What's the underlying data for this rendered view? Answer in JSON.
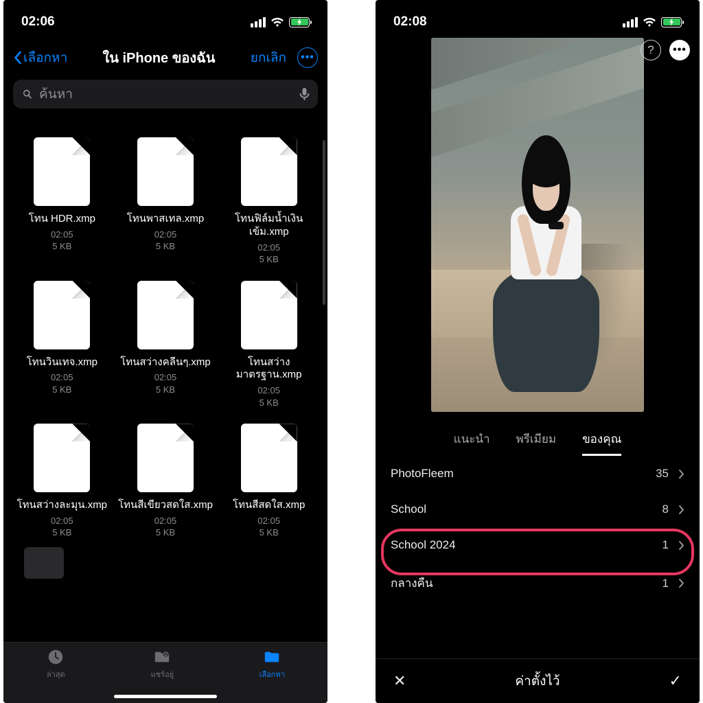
{
  "left": {
    "status": {
      "time": "02:06"
    },
    "nav": {
      "back": "เลือกหา",
      "title": "ใน iPhone ของฉัน",
      "cancel": "ยกเลิก"
    },
    "search": {
      "placeholder": "ค้นหา"
    },
    "files": [
      {
        "name": "โทน HDR.xmp",
        "time": "02:05",
        "size": "5 KB"
      },
      {
        "name": "โทนพาสเทล.xmp",
        "time": "02:05",
        "size": "5 KB"
      },
      {
        "name": "โทนฟิล์มน้ำเงินเข้ม.xmp",
        "time": "02:05",
        "size": "5 KB"
      },
      {
        "name": "โทนวินเทจ.xmp",
        "time": "02:05",
        "size": "5 KB"
      },
      {
        "name": "โทนสว่างคลีนๆ.xmp",
        "time": "02:05",
        "size": "5 KB"
      },
      {
        "name": "โทนสว่างมาตรฐาน.xmp",
        "time": "02:05",
        "size": "5 KB"
      },
      {
        "name": "โทนสว่างละมุน.xmp",
        "time": "02:05",
        "size": "5 KB"
      },
      {
        "name": "โทนสีเขียวสดใส.xmp",
        "time": "02:05",
        "size": "5 KB"
      },
      {
        "name": "โทนสีสดใส.xmp",
        "time": "02:05",
        "size": "5 KB"
      }
    ],
    "tabs": {
      "recent": "ล่าสุด",
      "shared": "แชร์อยู่",
      "browse": "เลือกหา"
    }
  },
  "right": {
    "status": {
      "time": "02:08"
    },
    "tabs": {
      "recommended": "แนะนำ",
      "premium": "พรีเมียม",
      "yours": "ของคุณ"
    },
    "presets": [
      {
        "name": "PhotoFleem",
        "count": "35"
      },
      {
        "name": "School",
        "count": "8"
      },
      {
        "name": "School 2024",
        "count": "1"
      },
      {
        "name": "กลางคืน",
        "count": "1"
      }
    ],
    "bottom": {
      "title": "ค่าตั้งไว้",
      "close": "✕",
      "confirm": "✓"
    }
  }
}
